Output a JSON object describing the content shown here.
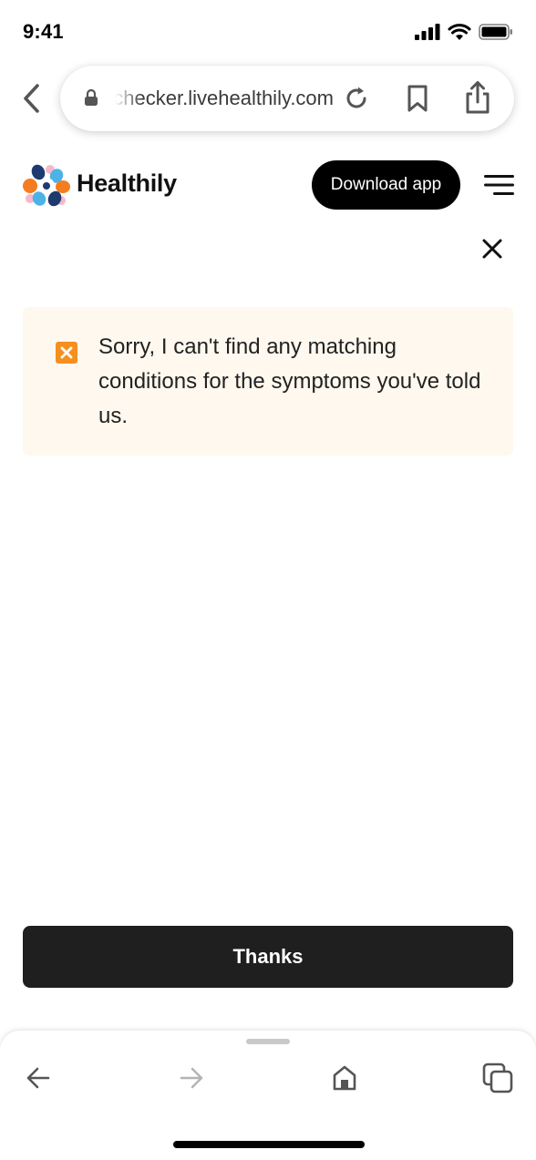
{
  "status_bar": {
    "time": "9:41",
    "icons": [
      "cellular-signal-icon",
      "wifi-icon",
      "battery-icon"
    ]
  },
  "browser": {
    "url": "symptomchecker.livehealthily.com",
    "icons": {
      "back": "chevron-left-icon",
      "lock": "lock-icon",
      "reload": "reload-icon",
      "bookmark": "bookmark-icon",
      "share": "share-icon"
    }
  },
  "header": {
    "brand": "Healthily",
    "download_label": "Download app",
    "menu_icon": "hamburger-menu-icon"
  },
  "alert": {
    "message": "Sorry, I can't find any matching conditions for the symptoms you've told us.",
    "icon": "close-square-icon",
    "background": "#fff8ee",
    "icon_color": "#f5901f"
  },
  "actions": {
    "thanks_label": "Thanks"
  },
  "toolbar": {
    "icons": [
      "arrow-left-icon",
      "arrow-right-icon",
      "home-icon",
      "tabs-icon"
    ]
  },
  "colors": {
    "button_dark": "#1f1f1f",
    "text": "#111111",
    "logo_navy": "#1e3a6e",
    "logo_blue": "#4db3e6",
    "logo_orange": "#f57c1f",
    "logo_pink": "#f5b8cc"
  }
}
